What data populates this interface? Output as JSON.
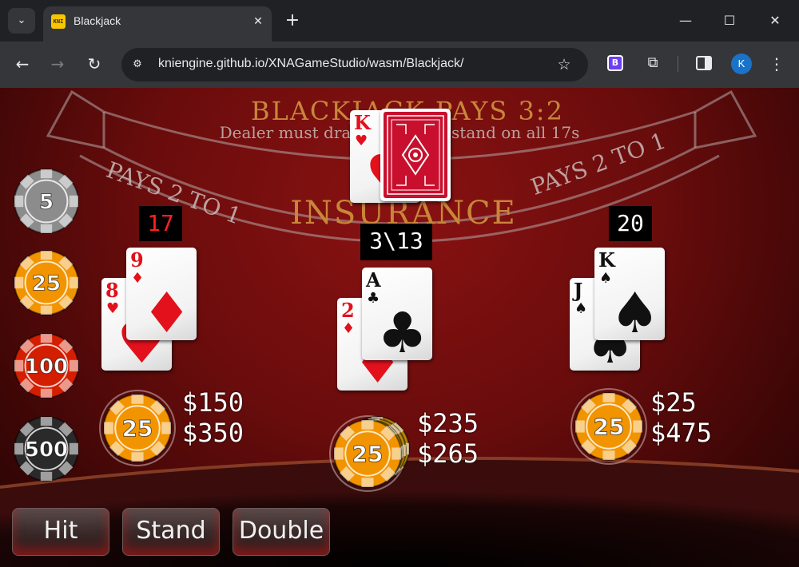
{
  "browser": {
    "tab_title": "Blackjack",
    "favicon_text": "KNI",
    "url": "kniengine.github.io/XNAGameStudio/wasm/Blackjack/",
    "extension_badge": "B",
    "profile_initial": "K",
    "icons": [
      "tab-search-icon",
      "close-icon",
      "new-tab-icon",
      "minimize-icon",
      "maximize-icon",
      "back-icon",
      "forward-icon",
      "reload-icon",
      "site-info-icon",
      "bookmark-star-icon",
      "extensions-puzzle-icon",
      "side-panel-icon",
      "menu-dots-icon"
    ]
  },
  "table": {
    "banner_line1": "BLACKJACK PAYS 3:2",
    "banner_line2": "Dealer must draw to 16 and stand on all 17s",
    "insurance_left": "PAYS 2 TO 1",
    "insurance_center": "INSURANCE",
    "insurance_right": "PAYS 2 TO 1",
    "felt_color": "#7a0e0e",
    "text_gold": "#c8863a"
  },
  "dealer": {
    "cards": [
      {
        "rank": "K",
        "suit": "♥",
        "color": "red",
        "face_up": true
      },
      {
        "rank": "",
        "suit": "",
        "color": "red",
        "face_up": false
      }
    ]
  },
  "chip_rack": [
    {
      "value": "5",
      "color": "#8c8c8c"
    },
    {
      "value": "25",
      "color": "#f29400"
    },
    {
      "value": "100",
      "color": "#d41e00"
    },
    {
      "value": "500",
      "color": "#2a2a2a"
    }
  ],
  "players": [
    {
      "score": "17",
      "score_bust": true,
      "cards": [
        {
          "rank": "8",
          "suit": "♥",
          "color": "red"
        },
        {
          "rank": "9",
          "suit": "♦",
          "color": "red"
        }
      ],
      "chip": "25",
      "bet": "$150",
      "balance": "$350"
    },
    {
      "score": "3\\13",
      "score_bust": false,
      "cards": [
        {
          "rank": "2",
          "suit": "♦",
          "color": "red"
        },
        {
          "rank": "A",
          "suit": "♣",
          "color": "black"
        }
      ],
      "chip": "25",
      "bet": "$235",
      "balance": "$265"
    },
    {
      "score": "20",
      "score_bust": false,
      "cards": [
        {
          "rank": "J",
          "suit": "♠",
          "color": "black"
        },
        {
          "rank": "K",
          "suit": "♠",
          "color": "black"
        }
      ],
      "chip": "25",
      "bet": "$25",
      "balance": "$475"
    }
  ],
  "actions": {
    "hit": "Hit",
    "stand": "Stand",
    "double": "Double"
  }
}
